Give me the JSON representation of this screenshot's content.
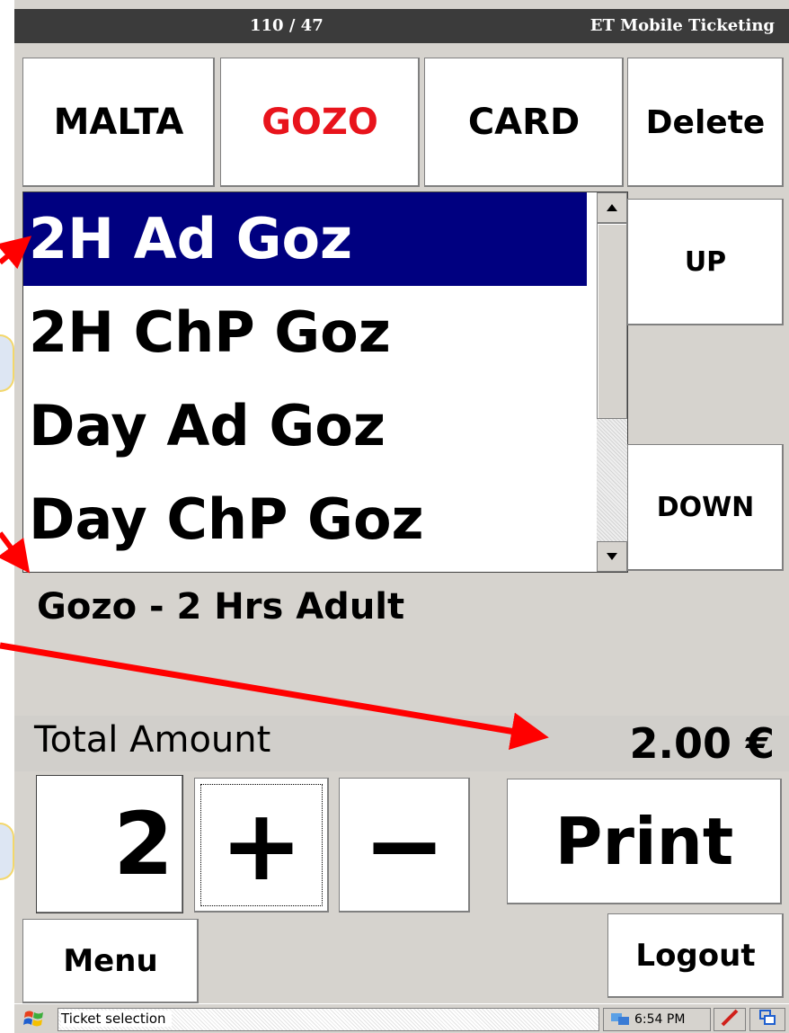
{
  "titlebar": {
    "counter": "110 / 47",
    "app_name": "ET Mobile Ticketing"
  },
  "top_buttons": {
    "malta": "MALTA",
    "gozo": "GOZO",
    "card": "CARD",
    "delete": "Delete"
  },
  "ticket_list": {
    "items": [
      "2H Ad Goz",
      "2H ChP Goz",
      "Day Ad Goz",
      "Day ChP Goz"
    ],
    "selected_index": 0
  },
  "nav": {
    "up": "UP",
    "down": "DOWN"
  },
  "description": "Gozo - 2 Hrs Adult",
  "total": {
    "label": "Total Amount",
    "value": "2.00 €"
  },
  "quantity": {
    "value": "2",
    "plus": "+",
    "minus": "−"
  },
  "actions": {
    "print": "Print",
    "menu": "Menu",
    "logout": "Logout"
  },
  "taskbar": {
    "task_label": "Ticket selection",
    "clock": "6:54 PM"
  },
  "icons": {
    "start": "windows-logo",
    "tray_network": "network-icon",
    "tray_pen": "pen-icon",
    "tray_windows": "windows-switch-icon",
    "scroll_up": "scroll-up-arrow",
    "scroll_down": "scroll-down-arrow"
  },
  "colors": {
    "accent_gozo": "#e8141c",
    "selection": "#000080",
    "arrow_annotation": "#ff0000"
  }
}
